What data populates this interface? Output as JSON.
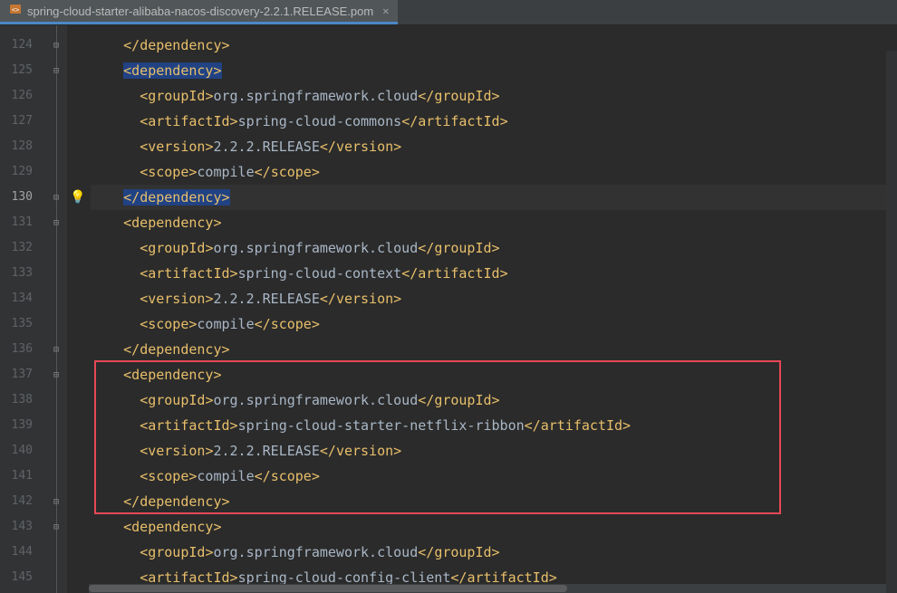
{
  "tab": {
    "filename": "spring-cloud-starter-alibaba-nacos-discovery-2.2.1.RELEASE.pom"
  },
  "current_line": 130,
  "lines": [
    {
      "num": 124,
      "indent": 2,
      "open": false,
      "close": true,
      "tag": "dependency",
      "content": ""
    },
    {
      "num": 125,
      "indent": 2,
      "open": true,
      "close": false,
      "tag": "dependency",
      "content": "",
      "hl": true
    },
    {
      "num": 126,
      "indent": 3,
      "open": true,
      "close": true,
      "tag": "groupId",
      "content": "org.springframework.cloud"
    },
    {
      "num": 127,
      "indent": 3,
      "open": true,
      "close": true,
      "tag": "artifactId",
      "content": "spring-cloud-commons"
    },
    {
      "num": 128,
      "indent": 3,
      "open": true,
      "close": true,
      "tag": "version",
      "content": "2.2.2.RELEASE"
    },
    {
      "num": 129,
      "indent": 3,
      "open": true,
      "close": true,
      "tag": "scope",
      "content": "compile"
    },
    {
      "num": 130,
      "indent": 2,
      "open": false,
      "close": true,
      "tag": "dependency",
      "content": "",
      "hl": true,
      "current": true
    },
    {
      "num": 131,
      "indent": 2,
      "open": true,
      "close": false,
      "tag": "dependency",
      "content": ""
    },
    {
      "num": 132,
      "indent": 3,
      "open": true,
      "close": true,
      "tag": "groupId",
      "content": "org.springframework.cloud"
    },
    {
      "num": 133,
      "indent": 3,
      "open": true,
      "close": true,
      "tag": "artifactId",
      "content": "spring-cloud-context"
    },
    {
      "num": 134,
      "indent": 3,
      "open": true,
      "close": true,
      "tag": "version",
      "content": "2.2.2.RELEASE"
    },
    {
      "num": 135,
      "indent": 3,
      "open": true,
      "close": true,
      "tag": "scope",
      "content": "compile"
    },
    {
      "num": 136,
      "indent": 2,
      "open": false,
      "close": true,
      "tag": "dependency",
      "content": ""
    },
    {
      "num": 137,
      "indent": 2,
      "open": true,
      "close": false,
      "tag": "dependency",
      "content": "",
      "box_start": true
    },
    {
      "num": 138,
      "indent": 3,
      "open": true,
      "close": true,
      "tag": "groupId",
      "content": "org.springframework.cloud"
    },
    {
      "num": 139,
      "indent": 3,
      "open": true,
      "close": true,
      "tag": "artifactId",
      "content": "spring-cloud-starter-netflix-ribbon"
    },
    {
      "num": 140,
      "indent": 3,
      "open": true,
      "close": true,
      "tag": "version",
      "content": "2.2.2.RELEASE"
    },
    {
      "num": 141,
      "indent": 3,
      "open": true,
      "close": true,
      "tag": "scope",
      "content": "compile"
    },
    {
      "num": 142,
      "indent": 2,
      "open": false,
      "close": true,
      "tag": "dependency",
      "content": "",
      "box_end": true
    },
    {
      "num": 143,
      "indent": 2,
      "open": true,
      "close": false,
      "tag": "dependency",
      "content": ""
    },
    {
      "num": 144,
      "indent": 3,
      "open": true,
      "close": true,
      "tag": "groupId",
      "content": "org.springframework.cloud"
    },
    {
      "num": 145,
      "indent": 3,
      "open": true,
      "close": true,
      "tag": "artifactId",
      "content": "spring-cloud-config-client"
    }
  ],
  "fold": {
    "marks_at": [
      124,
      125,
      130,
      131,
      136,
      137,
      142,
      143
    ]
  },
  "hint": {
    "bulb_at": 130
  }
}
